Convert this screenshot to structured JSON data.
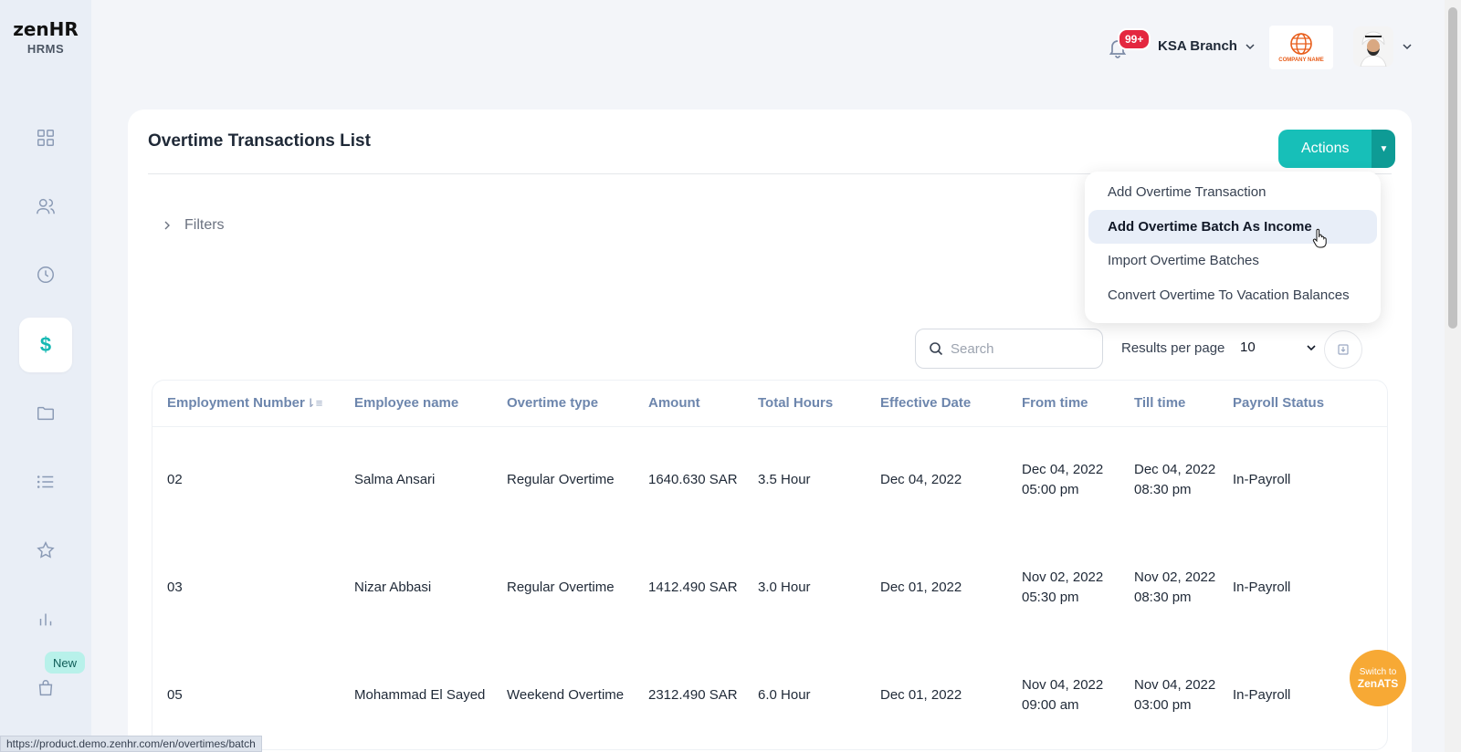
{
  "app": {
    "logo_main": "zen",
    "logo_hr": "HR",
    "logo_sub": "HRMS"
  },
  "sidebar": {
    "items": [
      {
        "name": "dashboard",
        "icon": "grid-icon"
      },
      {
        "name": "employees",
        "icon": "users-icon"
      },
      {
        "name": "attendance",
        "icon": "clock-icon"
      },
      {
        "name": "payroll",
        "icon": "dollar-icon",
        "active": true
      },
      {
        "name": "documents",
        "icon": "folder-icon"
      },
      {
        "name": "lists",
        "icon": "list-icon"
      },
      {
        "name": "performance",
        "icon": "star-icon"
      },
      {
        "name": "reports",
        "icon": "bar-chart-icon"
      },
      {
        "name": "marketplace",
        "icon": "bag-icon"
      }
    ],
    "new_badge": "New"
  },
  "header": {
    "notifications_count": "99+",
    "branch": "KSA Branch",
    "company_logo_text": "COMPANY NAME"
  },
  "page": {
    "title": "Overtime Transactions List",
    "actions_label": "Actions",
    "filters_label": "Filters",
    "actions_menu": [
      "Add Overtime Transaction",
      "Add Overtime Batch As Income",
      "Import Overtime Batches",
      "Convert Overtime To Vacation Balances"
    ],
    "search_placeholder": "Search",
    "results_per_page_label": "Results per page",
    "results_per_page_value": "10"
  },
  "table": {
    "columns": [
      "Employment Number",
      "Employee name",
      "Overtime type",
      "Amount",
      "Total Hours",
      "Effective Date",
      "From time",
      "Till time",
      "Payroll Status"
    ],
    "rows": [
      {
        "number": "02",
        "name": "Salma Ansari",
        "type": "Regular Overtime",
        "amount": "1640.630 SAR",
        "hours": "3.5 Hour",
        "effective": "Dec 04, 2022",
        "from": "Dec 04, 2022 05:00 pm",
        "till": "Dec 04, 2022 08:30 pm",
        "status": "In-Payroll"
      },
      {
        "number": "03",
        "name": "Nizar Abbasi",
        "type": "Regular Overtime",
        "amount": "1412.490 SAR",
        "hours": "3.0 Hour",
        "effective": "Dec 01, 2022",
        "from": "Nov 02, 2022 05:30 pm",
        "till": "Nov 02, 2022 08:30 pm",
        "status": "In-Payroll"
      },
      {
        "number": "05",
        "name": "Mohammad El Sayed",
        "type": "Weekend Overtime",
        "amount": "2312.490 SAR",
        "hours": "6.0 Hour",
        "effective": "Dec 01, 2022",
        "from": "Nov 04, 2022 09:00 am",
        "till": "Nov 04, 2022 03:00 pm",
        "status": "In-Payroll"
      }
    ]
  },
  "switch_bubble": {
    "line1": "Switch to",
    "line2": "ZenATS"
  },
  "status_bar": {
    "url": "https://product.demo.zenhr.com/en/overtimes/batch"
  },
  "colors": {
    "accent": "#17bfb8",
    "accent_dark": "#0e9b95",
    "badge_red": "#e4273f",
    "bubble_orange": "#f7a935"
  }
}
